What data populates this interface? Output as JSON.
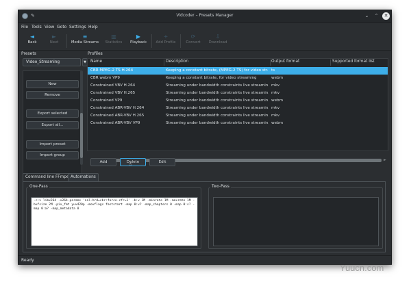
{
  "window": {
    "title": "Vidcoder – Presets Manager",
    "pin_glyph": "✎",
    "min_glyph": "⌄",
    "max_glyph": "⌃",
    "close_glyph": "✕"
  },
  "menu": {
    "items": [
      "File",
      "Tools",
      "View",
      "Goto",
      "Settings",
      "Help"
    ]
  },
  "toolbar": {
    "items": [
      {
        "label": "Back",
        "icon": "◄",
        "enabled": true
      },
      {
        "label": "Next",
        "icon": "►",
        "enabled": false
      },
      {
        "label": "Media Streams",
        "icon": "≡",
        "enabled": true
      },
      {
        "label": "Statistics",
        "icon": "▥",
        "enabled": false
      },
      {
        "label": "Playback",
        "icon": "▶",
        "enabled": true
      },
      {
        "label": "Add Profile",
        "icon": "+",
        "enabled": false
      },
      {
        "label": "Convert",
        "icon": "⟳",
        "enabled": false
      },
      {
        "label": "Download",
        "icon": "⇩",
        "enabled": false
      }
    ]
  },
  "presets": {
    "section_label": "Presets",
    "combo_value": "Video_Streaming",
    "combo_arrow": "▼",
    "buttons": [
      "New",
      "Remove",
      "Export selected",
      "Export all...",
      "Import preset",
      "Import group"
    ]
  },
  "profiles": {
    "section_label": "Profiles",
    "columns": [
      "Name",
      "Description",
      "Output format",
      "Supported format list"
    ],
    "rows": [
      [
        "CBR MPEG-2 TS H.264",
        "Keeping a constant bitrate, (MPEG-2 TS) for video str...",
        "ts",
        ""
      ],
      [
        "CBR webm VP9",
        "Keeping a constant bitrate, for video streaming",
        "webm",
        ""
      ],
      [
        "Constrained VBV H.264",
        "Streaming under bandwidth constraints live streamin...",
        "mkv",
        ""
      ],
      [
        "Constrained VBV H.265",
        "Streaming under bandwidth constraints live streamin...",
        "mkv",
        ""
      ],
      [
        "Constrained VP9",
        "Streaming under bandwidth constraints live streamin...",
        "webm",
        ""
      ],
      [
        "Constrained ABR-VBV H.264",
        "Streaming under bandwidth constraints live streamin...",
        "mkv",
        ""
      ],
      [
        "Constrained ABR-VBV H.265",
        "Streaming under bandwidth constraints live streamin...",
        "mkv",
        ""
      ],
      [
        "Constrained ABR-VBV VP9",
        "Streaming under bandwidth constraints live streamin...",
        "webm",
        ""
      ]
    ],
    "selected_row": 0,
    "scroll_arrow": "►",
    "buttons": [
      "Add",
      "Delete",
      "Edit"
    ]
  },
  "tabs": [
    {
      "label": "Command line FFmpeg",
      "active": true
    },
    {
      "label": "Automations",
      "active": false
    }
  ],
  "onepass": {
    "title": "One-Pass",
    "command": "-c:v libx264 -x264-params 'nal-hrd=cbr:force-cfr=1' -b:v 1M -minrate 1M -maxrate 1M -bufsize 2M -pix_fmt yuv420p -movflags faststart -map 0:v? -map_chapters 0 -map 0:s? -map 0:a? -map_metadata 0"
  },
  "twopass": {
    "title": "Two-Pass",
    "command": ""
  },
  "status": {
    "text": "Ready"
  },
  "cursor_glyph": "☝",
  "watermark": "Yuucn.com"
}
